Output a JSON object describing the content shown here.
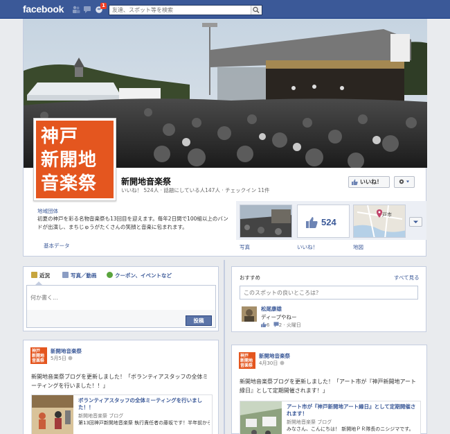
{
  "topbar": {
    "logo": "facebook",
    "notification_count": "1",
    "search_placeholder": "友達、スポット等を検索"
  },
  "page": {
    "profile_pic_text": [
      "神戸",
      "新開地",
      "音楽祭"
    ],
    "name": "新開地音楽祭",
    "stats": "いいね！ 524人 · 話題にしている人147人 · チェックイン 11件",
    "like_button": "いいね！",
    "category": "地域団体",
    "about": "初夏の神戸を彩る名物音楽祭も13回目を迎えます。毎年2日間で100組以上のバンドが出演し、まちじゅうがたくさんの笑顔と音楽に包まれます。",
    "basic_info": "基本データ"
  },
  "apps": [
    {
      "label": "写真"
    },
    {
      "label": "いいね！",
      "count": "524"
    },
    {
      "label": "地図",
      "city": "戸市"
    }
  ],
  "composer": {
    "tabs": [
      "近況",
      "写真／動画",
      "クーポン、イベントなど"
    ],
    "placeholder": "何か書く...",
    "post_button": "投稿"
  },
  "recommend": {
    "title": "おすすめ",
    "see_all": "すべて見る",
    "prompt": "このスポットの良いところは？",
    "user": "松尾康雄",
    "text": "ディープやねー",
    "likes": "6",
    "comments": "2",
    "day": "火曜日"
  },
  "posts": [
    {
      "name": "新開地音楽祭",
      "date": "5月5日",
      "text": "新開地音楽祭ブログを更新しました！「ボランティアスタッフの全体ミーティングを行いました！！」",
      "link_title": "ボランティアスタッフの全体ミーティングを行いました！！",
      "link_source": "新開地音楽祭 ブログ",
      "link_desc": "第13回神戸新開地音楽祭 執行責任者の藤坂です！半年前から準備を進めてきましたが、ついに音楽祭本"
    },
    {
      "name": "新開地音楽祭",
      "date": "4月30日",
      "text": "新開地音楽祭ブログを更新しました！「アート市が『神戸新開地アート縁日』として定期開催されます！」",
      "link_title": "アート市が『神戸新開地アート縁日』として定期開催されます！",
      "link_source": "新開地音楽祭 ブログ",
      "link_desc": "みなさん、こんにちは！ 新開地ＰＲ隊長のニシジマです。"
    }
  ],
  "colors": {
    "facebook_blue": "#3b5998",
    "brand_orange": "#e4561f",
    "background": "#e9ebee"
  }
}
